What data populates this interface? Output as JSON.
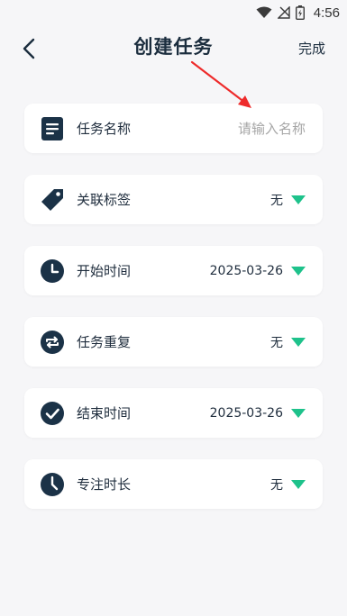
{
  "status_bar": {
    "time": "4:56"
  },
  "header": {
    "title": "创建任务",
    "done_label": "完成"
  },
  "form": {
    "task_name": {
      "label": "任务名称",
      "placeholder": "请输入名称",
      "value": ""
    },
    "tags": {
      "label": "关联标签",
      "value": "无"
    },
    "start_time": {
      "label": "开始时间",
      "value": "2025-03-26"
    },
    "repeat": {
      "label": "任务重复",
      "value": "无"
    },
    "end_time": {
      "label": "结束时间",
      "value": "2025-03-26"
    },
    "focus_duration": {
      "label": "专注时长",
      "value": "无"
    }
  },
  "colors": {
    "icon_dark": "#1b3247",
    "caret_green": "#1ec28b",
    "annotation_red": "#ee2b2b",
    "background": "#f6f6f8"
  },
  "icons": [
    "wifi-icon",
    "signal-icon",
    "battery-icon",
    "back-arrow-icon",
    "document-icon",
    "tag-icon",
    "clock-icon",
    "repeat-icon",
    "check-circle-icon",
    "timer-icon",
    "caret-down-icon"
  ]
}
